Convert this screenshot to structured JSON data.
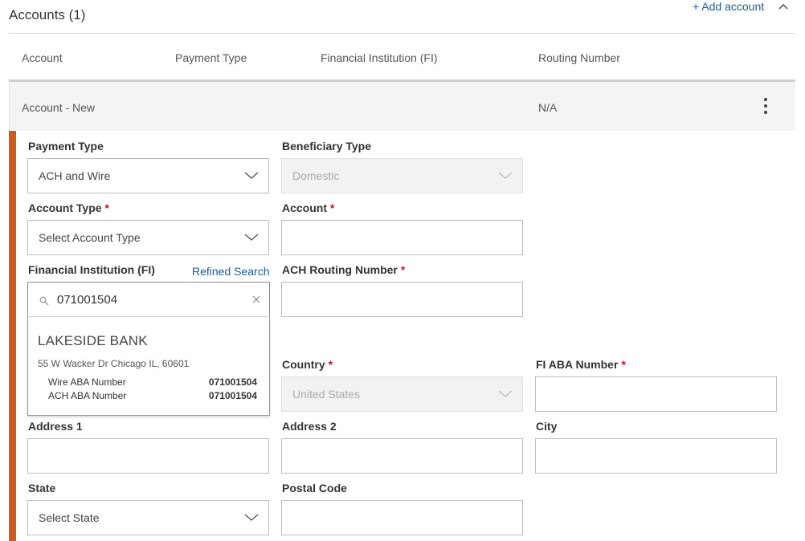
{
  "header": {
    "title": "Accounts (1)",
    "add_label": "+ Add account"
  },
  "columns": [
    "Account",
    "Payment Type",
    "Financial Institution (FI)",
    "Routing Number"
  ],
  "row": {
    "account": "Account - New",
    "routing": "N/A"
  },
  "form": {
    "payment_type": {
      "label": "Payment Type",
      "value": "ACH and Wire"
    },
    "beneficiary_type": {
      "label": "Beneficiary Type",
      "value": "Domestic"
    },
    "account_type": {
      "label": "Account Type",
      "value": "Select Account Type"
    },
    "account": {
      "label": "Account",
      "value": ""
    },
    "fi": {
      "label": "Financial Institution (FI)",
      "refined_label": "Refined Search",
      "search_value": "071001504"
    },
    "ach_routing": {
      "label": "ACH Routing Number",
      "value": ""
    },
    "country": {
      "label": "Country",
      "value": "United States"
    },
    "fi_aba": {
      "label": "FI ABA Number",
      "value": ""
    },
    "address1": {
      "label": "Address 1",
      "value": ""
    },
    "address2": {
      "label": "Address 2",
      "value": ""
    },
    "city": {
      "label": "City",
      "value": ""
    },
    "state": {
      "label": "State",
      "value": "Select State"
    },
    "postal": {
      "label": "Postal Code",
      "value": ""
    },
    "required_mark": "*"
  },
  "suggestion": {
    "name": "LAKESIDE BANK",
    "address": "55 W Wacker Dr Chicago IL, 60601",
    "wire_label": "Wire ABA Number",
    "wire_value": "071001504",
    "ach_label": "ACH ABA Number",
    "ach_value": "071001504"
  },
  "colors": {
    "accent": "#cc5c1b",
    "link": "#1a5a96",
    "required": "#c8102e"
  }
}
